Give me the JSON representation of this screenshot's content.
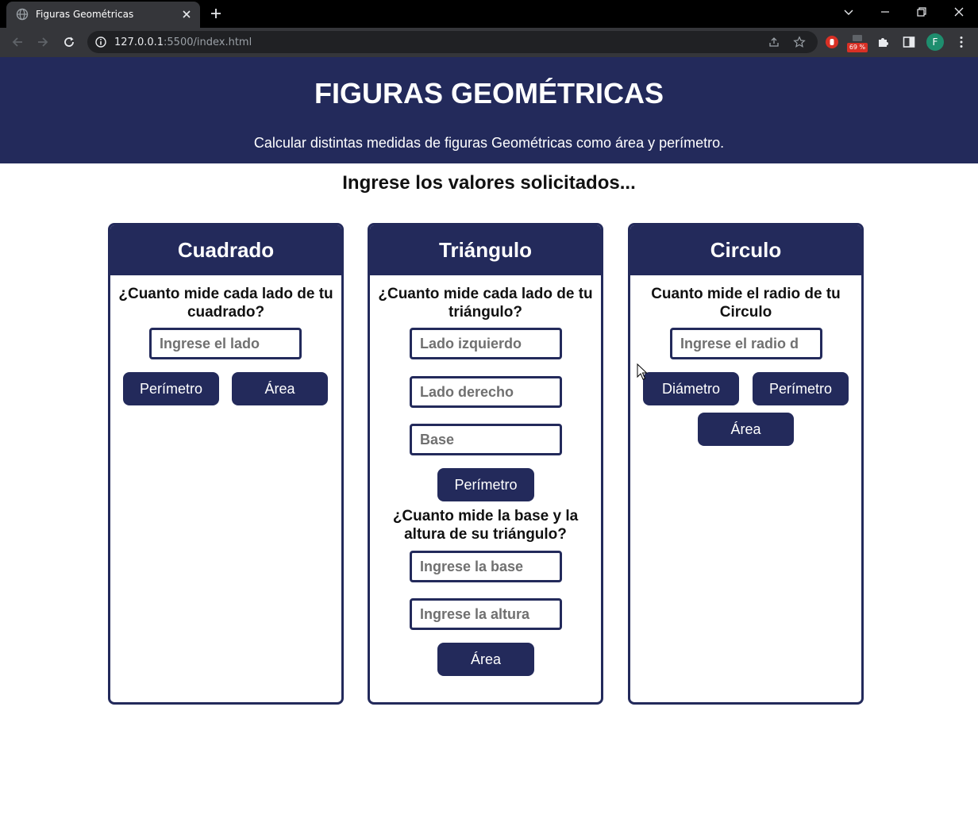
{
  "browser": {
    "tab_title": "Figuras Geométricas",
    "url_host": "127.0.0.1",
    "url_rest": ":5500/index.html",
    "extension_badge": "69 %",
    "profile_initial": "F"
  },
  "header": {
    "title": "FIGURAS GEOMÉTRICAS",
    "subtitle": "Calcular distintas medidas de figuras Geométricas como área y perímetro."
  },
  "prompt": "Ingrese los valores solicitados...",
  "cards": {
    "square": {
      "title": "Cuadrado",
      "question": "¿Cuanto mide cada lado de tu cuadrado?",
      "input_placeholder": "Ingrese el lado",
      "perimeter_label": "Perímetro",
      "area_label": "Área"
    },
    "triangle": {
      "title": "Triángulo",
      "question_sides": "¿Cuanto mide cada lado de tu triángulo?",
      "left_placeholder": "Lado izquierdo",
      "right_placeholder": "Lado derecho",
      "base_placeholder": "Base",
      "perimeter_label": "Perímetro",
      "question_area": "¿Cuanto mide la base y la altura de su triángulo?",
      "area_base_placeholder": "Ingrese la base",
      "area_height_placeholder": "Ingrese la altura",
      "area_label": "Área"
    },
    "circle": {
      "title": "Circulo",
      "question": "Cuanto mide el radio de tu Circulo",
      "input_placeholder": "Ingrese el radio d",
      "diameter_label": "Diámetro",
      "perimeter_label": "Perímetro",
      "area_label": "Área"
    }
  },
  "colors": {
    "primary": "#232a5b",
    "page_bg": "#ffffff",
    "browser_frame": "#35363a"
  }
}
